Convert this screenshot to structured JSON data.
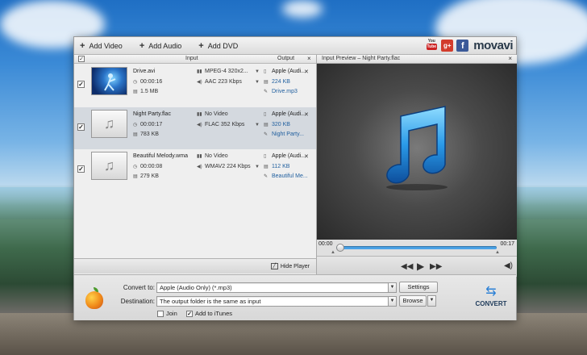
{
  "toolbar": {
    "add_video": "Add Video",
    "add_audio": "Add Audio",
    "add_dvd": "Add DVD",
    "youtube_you": "You",
    "youtube_tube": "Tube",
    "gplus": "g+",
    "facebook": "f",
    "brand": "movavi"
  },
  "list": {
    "header_input": "Input",
    "header_output": "Output",
    "header_check": "✓",
    "header_close": "×",
    "items": [
      {
        "name": "Drive.avi",
        "duration": "00:00:16",
        "size": "1.5 MB",
        "video": "MPEG-4 320x2...",
        "audio": "AAC 223 Kbps",
        "out_format": "Apple (Audi...",
        "out_size": "224 KB",
        "out_file": "Drive.mp3",
        "checked": "✓",
        "thumb": "video",
        "selected": false
      },
      {
        "name": "Night Party.flac",
        "duration": "00:00:17",
        "size": "783 KB",
        "video": "No Video",
        "audio": "FLAC 352 Kbps",
        "out_format": "Apple (Audi...",
        "out_size": "320 KB",
        "out_file": "Night Party...",
        "checked": "✓",
        "thumb": "audio",
        "selected": true
      },
      {
        "name": "Beautiful Melody.wma",
        "duration": "00:00:08",
        "size": "279 KB",
        "video": "No Video",
        "audio": "WMAV2 224 Kbps",
        "out_format": "Apple (Audi...",
        "out_size": "112 KB",
        "out_file": "Beautiful Me...",
        "checked": "✓",
        "thumb": "audio",
        "selected": false
      }
    ],
    "hide_player": "Hide Player"
  },
  "preview": {
    "title": "Input Preview – Night Party.flac",
    "close": "×",
    "time_start": "00:00",
    "time_end": "00:17",
    "progress": 0
  },
  "bottom": {
    "convert_to_label": "Convert to:",
    "convert_to_value": "Apple (Audio Only) (*.mp3)",
    "settings": "Settings",
    "destination_label": "Destination:",
    "destination_value": "The output folder is the same as input",
    "browse": "Browse",
    "join": "Join",
    "add_itunes": "Add to iTunes",
    "add_itunes_checked": "✓",
    "convert": "CONVERT"
  },
  "colors": {
    "accent_blue": "#1f5e9e",
    "selected_row": "#d4d9df",
    "progress": "#4aa3e8"
  }
}
